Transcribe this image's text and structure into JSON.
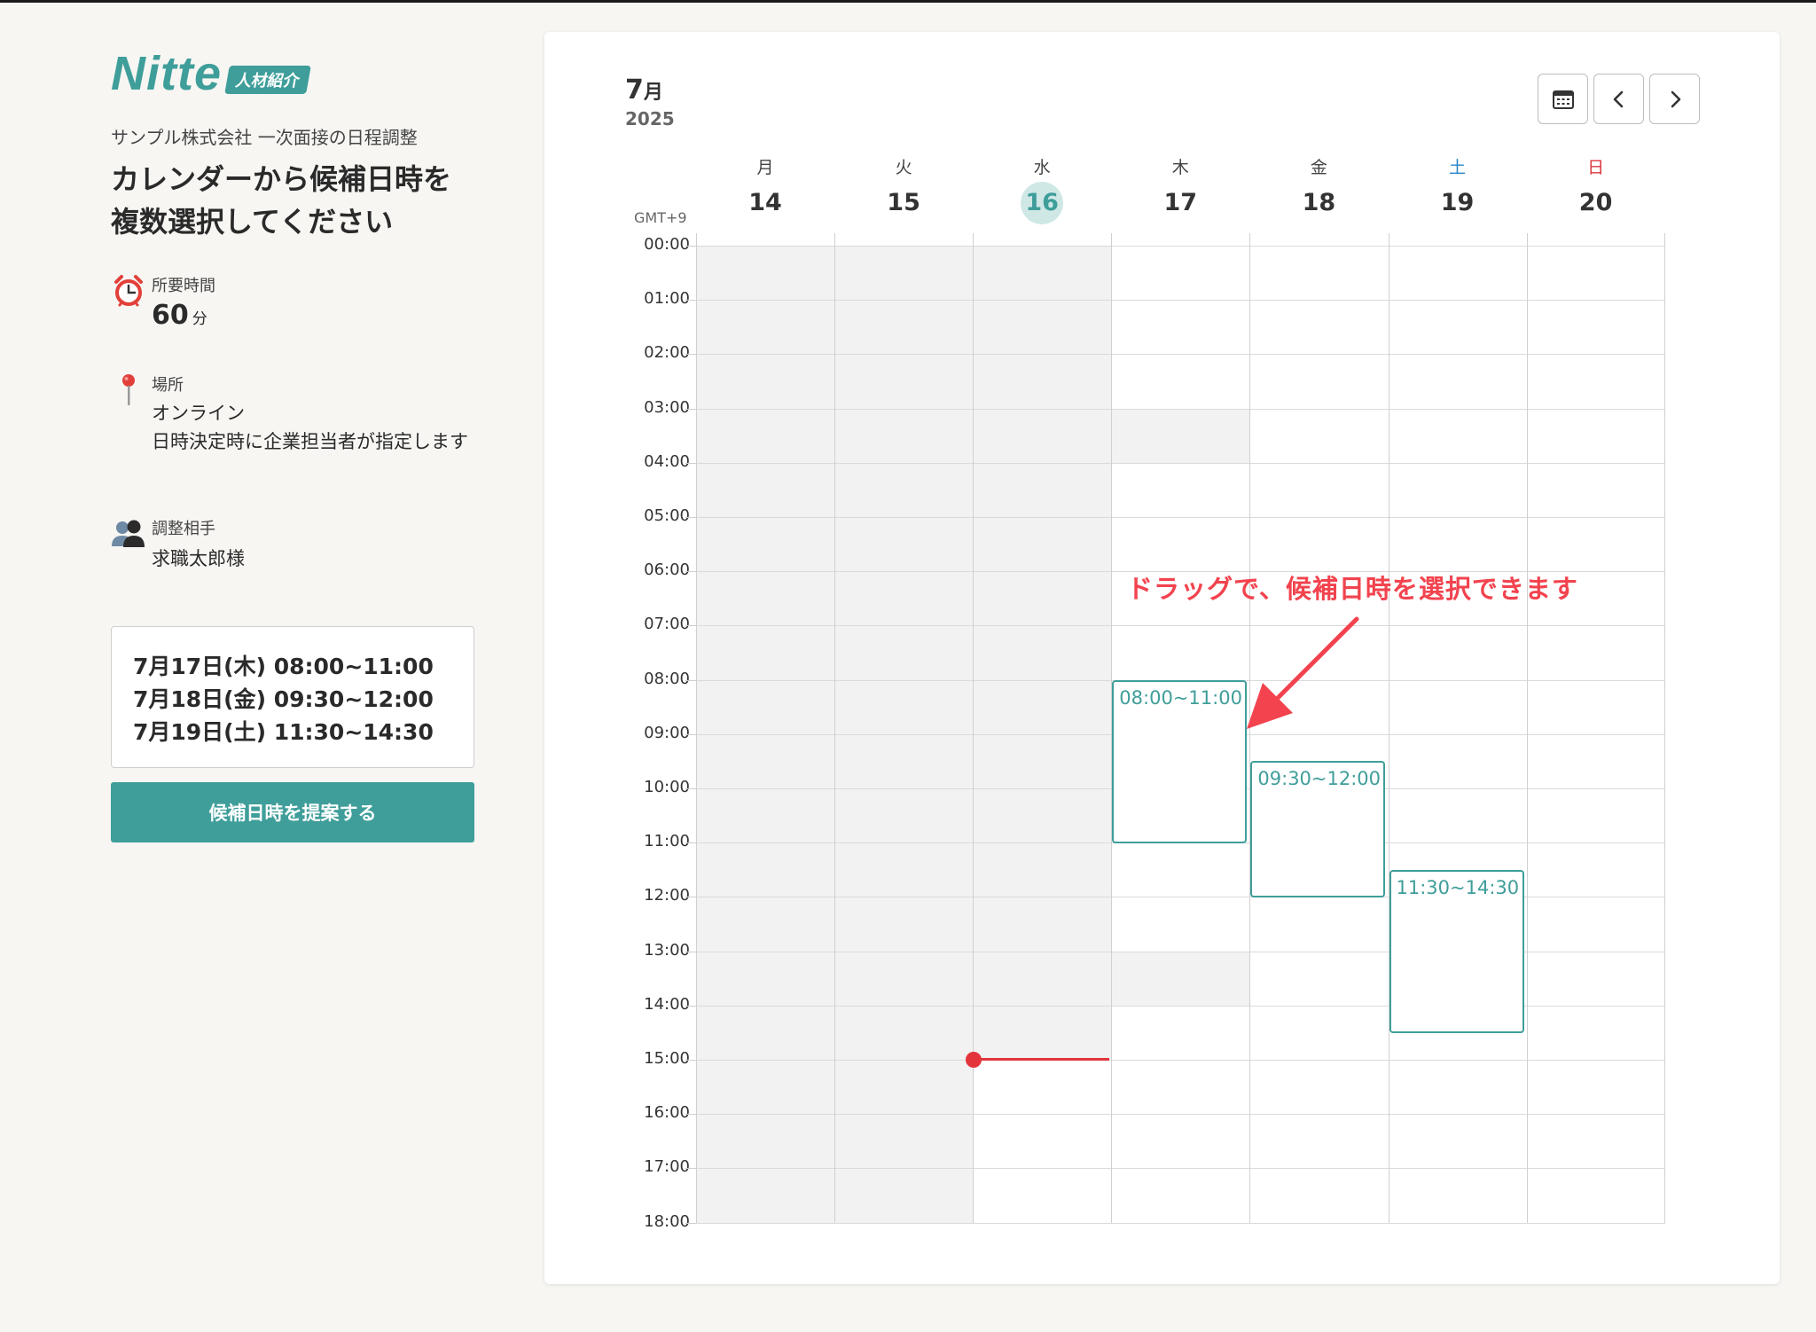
{
  "brand": {
    "name": "Nitte",
    "badge": "人材紹介",
    "accent_color": "#3f9e9a"
  },
  "sidebar": {
    "company_line": "サンプル株式会社 一次面接の日程調整",
    "headline_line1": "カレンダーから候補日時を",
    "headline_line2": "複数選択してください",
    "duration": {
      "icon": "alarm-clock-icon",
      "label": "所要時間",
      "value": "60",
      "unit": "分"
    },
    "location": {
      "icon": "map-pin-icon",
      "label": "場所",
      "value": "オンライン",
      "note": "日時決定時に企業担当者が指定します"
    },
    "partner": {
      "icon": "people-icon",
      "label": "調整相手",
      "value": "求職太郎様"
    },
    "selected_slots": [
      "7月17日(木) 08:00~11:00",
      "7月18日(金) 09:30~12:00",
      "7月19日(土) 11:30~14:30"
    ],
    "propose_button": "候補日時を提案する"
  },
  "calendar": {
    "month": "7",
    "month_unit": "月",
    "year": "2025",
    "timezone": "GMT+9",
    "nav": {
      "calendar_icon": "calendar-icon",
      "prev_icon": "chevron-left-icon",
      "next_icon": "chevron-right-icon"
    },
    "days": [
      {
        "dow": "月",
        "date": "14"
      },
      {
        "dow": "火",
        "date": "15"
      },
      {
        "dow": "水",
        "date": "16",
        "today": true
      },
      {
        "dow": "木",
        "date": "17"
      },
      {
        "dow": "金",
        "date": "18"
      },
      {
        "dow": "土",
        "date": "19",
        "color": "#2a85c7"
      },
      {
        "dow": "日",
        "date": "20",
        "color": "#d8363f"
      }
    ],
    "hours": [
      "00:00",
      "01:00",
      "02:00",
      "03:00",
      "04:00",
      "05:00",
      "06:00",
      "07:00",
      "08:00",
      "09:00",
      "10:00",
      "11:00",
      "12:00",
      "13:00",
      "14:00",
      "15:00",
      "16:00",
      "17:00",
      "18:00"
    ],
    "events": [
      {
        "day_index": 3,
        "start": 8,
        "end": 11,
        "label": "08:00~11:00"
      },
      {
        "day_index": 4,
        "start": 9.5,
        "end": 12,
        "label": "09:30~12:00"
      },
      {
        "day_index": 5,
        "start": 11.5,
        "end": 14.5,
        "label": "11:30~14:30"
      }
    ],
    "unavailable": [
      {
        "day_index": 0,
        "start": 0,
        "end": 18
      },
      {
        "day_index": 1,
        "start": 0,
        "end": 18
      },
      {
        "day_index": 2,
        "start": 0,
        "end": 15
      },
      {
        "day_index": 3,
        "start": 3,
        "end": 4
      },
      {
        "day_index": 3,
        "start": 13,
        "end": 14
      }
    ],
    "current_time": "15:00",
    "annotation": "ドラッグで、候補日時を選択できます",
    "annotation_color": "#f2434e"
  }
}
